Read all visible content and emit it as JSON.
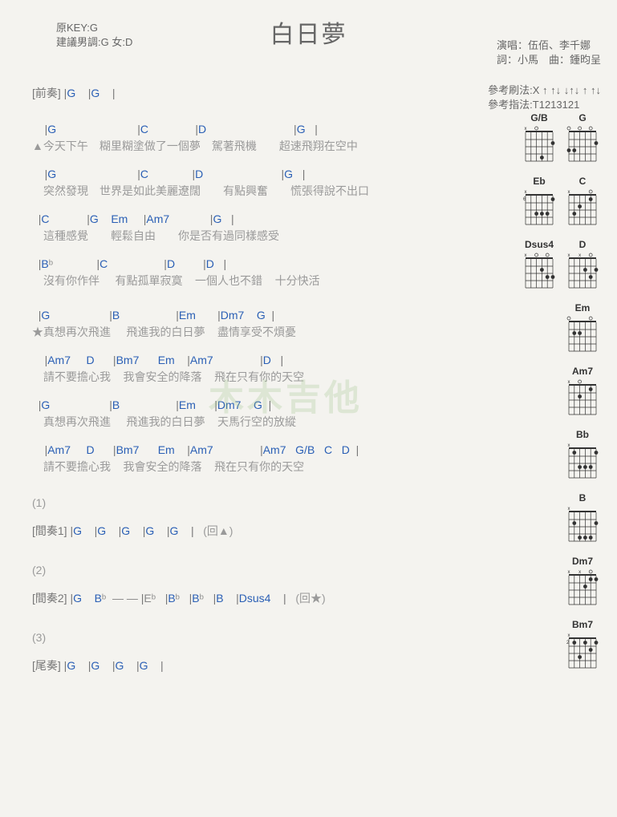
{
  "title": "白日夢",
  "meta_left": {
    "l1": "原KEY:G",
    "l2": "建議男調:G 女:D"
  },
  "meta_right": {
    "l1": "演唱：伍佰、李千娜",
    "l2": "詞：小馬　曲：鍾昀呈"
  },
  "ref": {
    "l1": "參考刷法:X ↑ ↑↓ ↓↑↓ ↑ ↑↓",
    "l2": "參考指法:T1213121"
  },
  "intro": {
    "label": "[前奏]",
    "bars": "|G    |G    |"
  },
  "v1": [
    {
      "c": "    |G                          |C               |D                            |G   |",
      "l": "▲今天下午　糊里糊塗做了一個夢　駕著飛機　　超速飛翔在空中"
    },
    {
      "c": "    |G                          |C              |D                         |G   |",
      "l": "　突然發現　世界是如此美麗遼闊　　有點興奮　　慌張得說不出口"
    },
    {
      "c": "  |C            |G    Em     |Am7             |G   |",
      "l": "　這種感覺　　輕鬆自由　　你是否有過同樣感受"
    },
    {
      "c": "  |Bᵇ              |C                  |D         |D   |",
      "l": "　沒有你作伴     有點孤單寂寞    一個人也不錯    十分快活"
    }
  ],
  "chorus": [
    {
      "c": "  |G                   |B                  |Em       |Dm7    G  |",
      "l": "★真想再次飛進     飛進我的白日夢    盡情享受不煩憂"
    },
    {
      "c": "    |Am7     D      |Bm7      Em    |Am7               |D   |",
      "l": "　請不要擔心我    我會安全的降落    飛在只有你的天空"
    },
    {
      "c": "  |G                   |B                  |Em      |Dm7    G  |",
      "l": "　真想再次飛進     飛進我的白日夢    天馬行空的放縱"
    },
    {
      "c": "    |Am7     D      |Bm7      Em    |Am7               |Am7   G/B   C   D  |",
      "l": "　請不要擔心我    我會安全的降落    飛在只有你的天空"
    }
  ],
  "inter1": {
    "n": "(1)",
    "label": "[間奏1]",
    "bars": "|G    |G    |G    |G    |G    |",
    "cue": "(回▲)"
  },
  "inter2": {
    "n": "(2)",
    "label": "[間奏2]",
    "bars": "|G    Bᵇ  — — |Eᵇ   |Bᵇ   |Bᵇ   |B    |Dsus4    |",
    "cue": "(回★)"
  },
  "outro": {
    "n": "(3)",
    "label": "[尾奏]",
    "bars": "|G    |G    |G    |G    |"
  },
  "diagrams": [
    [
      {
        "name": "G/B",
        "marks": "x o",
        "dots": [
          [
            2,
            1
          ],
          [
            4,
            3
          ]
        ]
      },
      {
        "name": "G",
        "marks": "o o o",
        "dots": [
          [
            2,
            1
          ],
          [
            3,
            5
          ],
          [
            3,
            6
          ]
        ]
      }
    ],
    [
      {
        "name": "Eb",
        "marks": "x",
        "pos": "6",
        "dots": [
          [
            1,
            1
          ],
          [
            3,
            2
          ],
          [
            3,
            3
          ],
          [
            3,
            4
          ]
        ]
      },
      {
        "name": "C",
        "marks": "x   o o",
        "dots": [
          [
            1,
            2
          ],
          [
            2,
            4
          ],
          [
            3,
            5
          ]
        ]
      }
    ],
    [
      {
        "name": "Dsus4",
        "marks": "x o o",
        "dots": [
          [
            2,
            3
          ],
          [
            3,
            2
          ],
          [
            3,
            1
          ]
        ]
      },
      {
        "name": "D",
        "marks": "x x o",
        "dots": [
          [
            2,
            3
          ],
          [
            2,
            1
          ],
          [
            3,
            2
          ]
        ]
      }
    ],
    [
      {
        "name": "Em",
        "marks": "o   o o o",
        "dots": [
          [
            2,
            4
          ],
          [
            2,
            5
          ]
        ]
      }
    ],
    [
      {
        "name": "Am7",
        "marks": "x o   o o",
        "dots": [
          [
            1,
            2
          ],
          [
            2,
            4
          ]
        ]
      }
    ],
    [
      {
        "name": "Bb",
        "marks": "x",
        "dots": [
          [
            1,
            1
          ],
          [
            1,
            5
          ],
          [
            3,
            2
          ],
          [
            3,
            3
          ],
          [
            3,
            4
          ]
        ]
      }
    ],
    [
      {
        "name": "B",
        "marks": "x",
        "dots": [
          [
            2,
            1
          ],
          [
            2,
            5
          ],
          [
            4,
            2
          ],
          [
            4,
            3
          ],
          [
            4,
            4
          ]
        ]
      }
    ],
    [
      {
        "name": "Dm7",
        "marks": "x x o",
        "dots": [
          [
            1,
            1
          ],
          [
            1,
            2
          ],
          [
            2,
            3
          ]
        ]
      }
    ],
    [
      {
        "name": "Bm7",
        "marks": "x",
        "pos": "2",
        "dots": [
          [
            1,
            1
          ],
          [
            1,
            3
          ],
          [
            1,
            5
          ],
          [
            2,
            2
          ],
          [
            3,
            4
          ]
        ]
      }
    ]
  ],
  "watermark": "木木吉他"
}
